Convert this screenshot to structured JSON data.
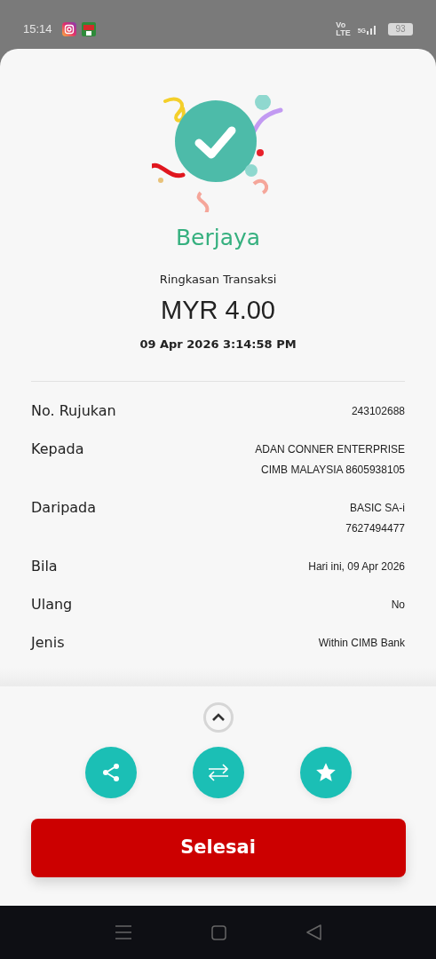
{
  "status_bar": {
    "time": "15:14",
    "volte_top": "Vo",
    "volte_bottom": "LTE",
    "network": "5G",
    "battery": "93"
  },
  "result": {
    "status": "Berjaya",
    "summary_title": "Ringkasan Transaksi",
    "amount": "MYR 4.00",
    "datetime": "09 Apr 2026 3:14:58 PM"
  },
  "details": [
    {
      "label": "No. Rujukan",
      "values": [
        "243102688"
      ]
    },
    {
      "label": "Kepada",
      "values": [
        "ADAN CONNER ENTERPRISE",
        "CIMB MALAYSIA 8605938105"
      ]
    },
    {
      "label": "Daripada",
      "values": [
        "BASIC SA-i",
        "7627494477"
      ]
    },
    {
      "label": "Bila",
      "values": [
        "Hari ini, 09 Apr 2026"
      ]
    },
    {
      "label": "Ulang",
      "values": [
        "No"
      ]
    },
    {
      "label": "Jenis",
      "values": [
        "Within CIMB Bank"
      ]
    }
  ],
  "actions": [
    {
      "kind": "share"
    },
    {
      "kind": "transfer"
    },
    {
      "kind": "favourite"
    }
  ],
  "primary_button": "Selesai"
}
